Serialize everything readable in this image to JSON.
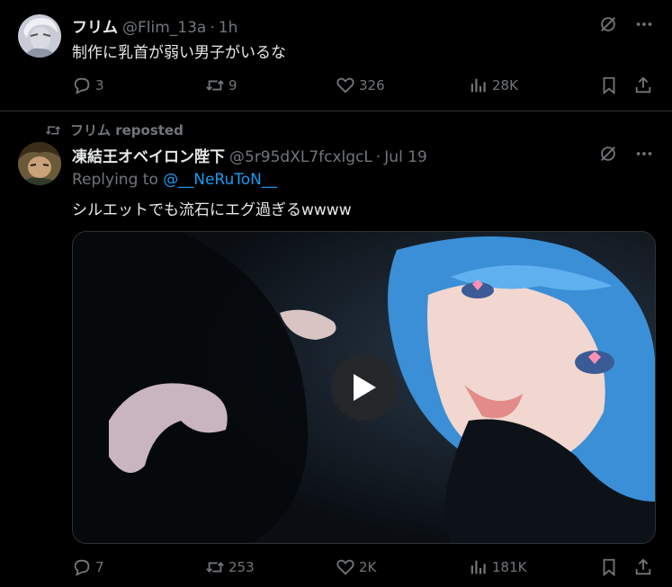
{
  "tweet1": {
    "name": "フリム",
    "handle": "@Flim_13a",
    "dot": "·",
    "time": "1h",
    "text": "制作に乳首が弱い男子がいるな",
    "replies": "3",
    "reposts": "9",
    "likes": "326",
    "views": "28K"
  },
  "tweet2": {
    "repost_by": "フリム reposted",
    "name": "凍結王オベイロン陛下",
    "handle": "@5r95dXL7fcxlgcL",
    "dot": "·",
    "time": "Jul 19",
    "replying_prefix": "Replying to ",
    "replying_to": "@__NeRuToN__",
    "text": "シルエットでも流石にエグ過ぎるwwww",
    "replies": "7",
    "reposts": "253",
    "likes": "2K",
    "views": "181K"
  },
  "colors": {
    "background": "#000000",
    "text": "#e7e9ea",
    "muted": "#71767b",
    "link": "#1d9bf0",
    "divider": "#2f3336"
  }
}
